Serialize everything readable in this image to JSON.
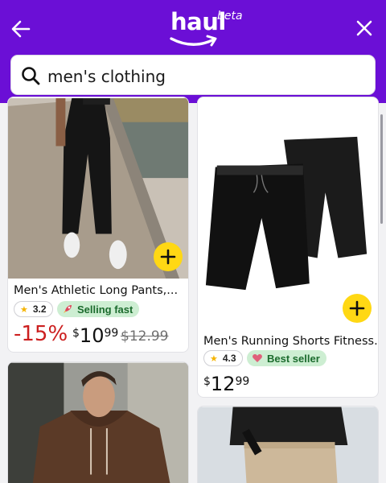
{
  "header": {
    "logo_word": "haul",
    "logo_badge": "beta",
    "back_icon": "arrow-left-icon",
    "close_icon": "close-icon",
    "background": "#6b0fd6"
  },
  "search": {
    "query": "men's clothing",
    "icon": "search-icon"
  },
  "products": [
    {
      "title": "Men's Athletic Long Pants,...",
      "rating": "3.2",
      "badge": "Selling fast",
      "badge_icon": "rocket-icon",
      "discount": "-15%",
      "price_symbol": "$",
      "price_whole": "10",
      "price_cents": "99",
      "list_price": "$12.99"
    },
    {
      "title": "Men's Running Shorts Fitness...",
      "rating": "4.3",
      "badge": "Best seller",
      "badge_icon": "heart-icon",
      "price_symbol": "$",
      "price_whole": "12",
      "price_cents": "99"
    },
    {
      "title": "",
      "image": "brown-hoodie-photo"
    },
    {
      "title": "",
      "image": "khaki-pants-photo"
    }
  ],
  "colors": {
    "accent": "#6b0fd6",
    "add_button": "#ffd814",
    "discount": "#cc1f1f",
    "badge_bg": "#cdeed2"
  }
}
